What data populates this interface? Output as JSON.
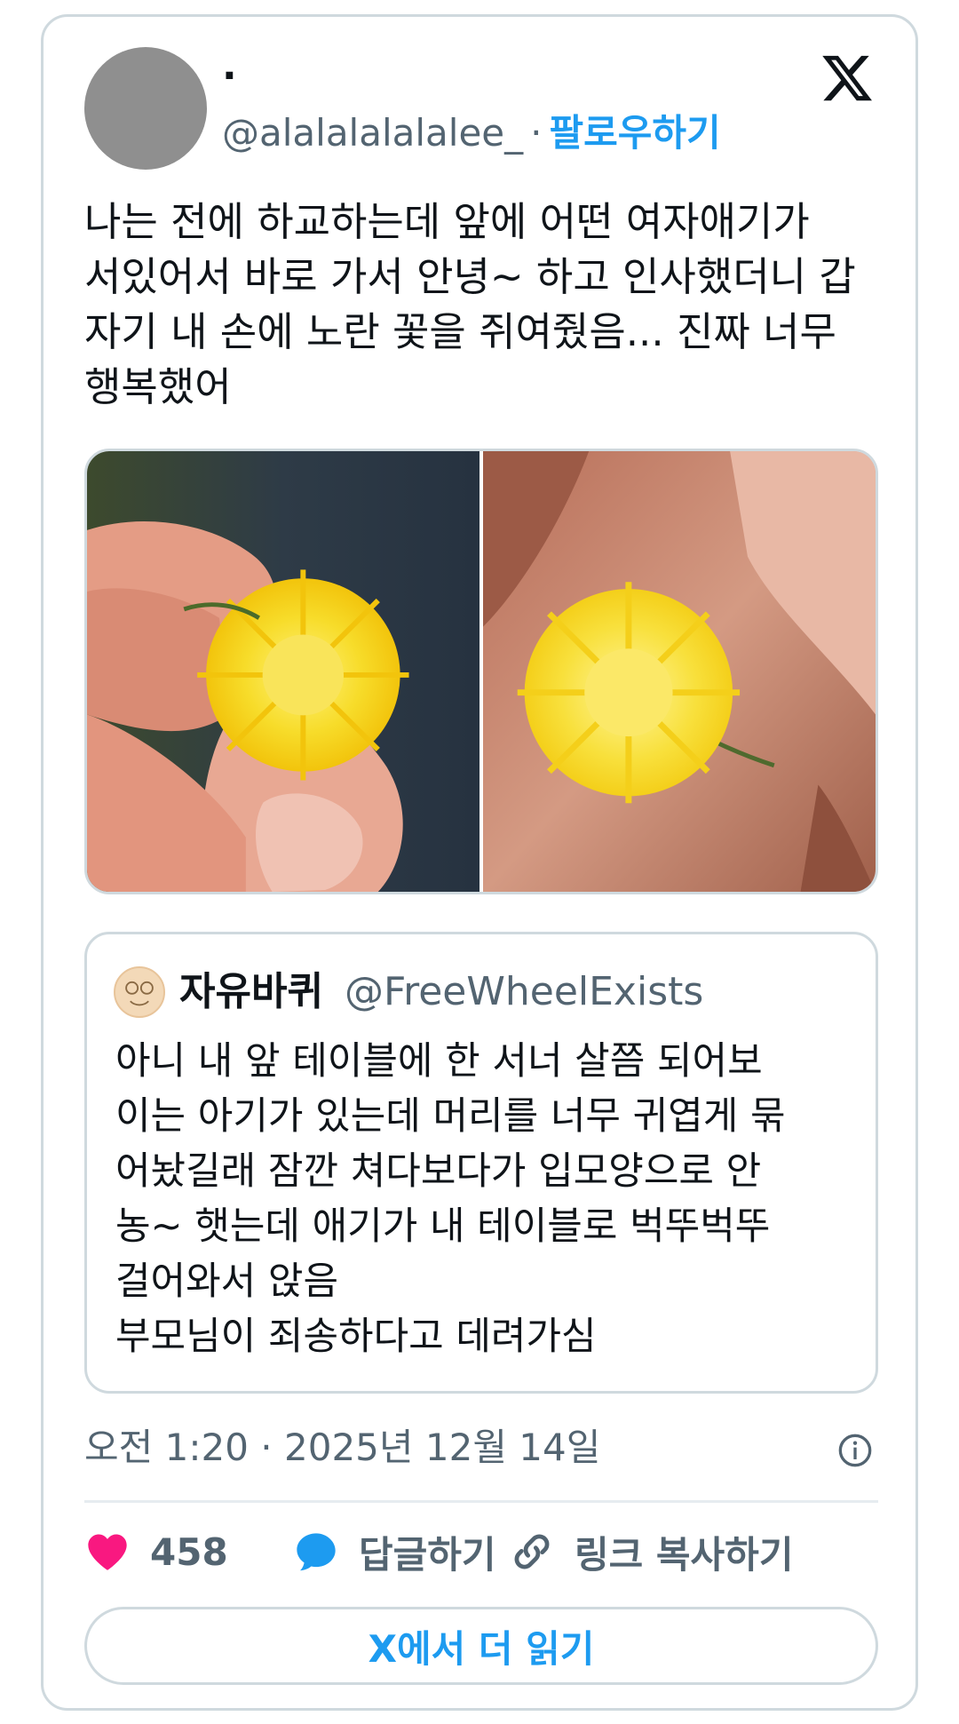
{
  "author": {
    "display_name": "·",
    "handle": "@alalalalalalee_",
    "separator": "·",
    "follow_label": "팔로우하기"
  },
  "tweet": {
    "text": "나는 전에 하교하는데 앞에 어떤 여자애기가\n서있어서 바로 가서 안녕~ 하고 인사했더니 갑\n자기 내 손에 노란 꽃을 쥐여줬음... 진짜 너무\n행복했어"
  },
  "quoted_tweet": {
    "display_name": "자유바퀴",
    "handle": "@FreeWheelExists",
    "text": "아니 내 앞 테이블에 한 서너 살쯤 되어보\n이는 아기가 있는데 머리를 너무 귀엽게 묶\n어놨길래 잠깐 쳐다보다가 입모양으로 안\n농~ 햇는데 애기가 내 테이블로 벅뚜벅뚜\n걸어와서 앉음\n부모님이 죄송하다고 데려가심"
  },
  "timestamp": "오전 1:20 · 2025년 12월 14일",
  "actions": {
    "like_count": "458",
    "reply_label": "답글하기",
    "copy_link_label": "링크 복사하기"
  },
  "read_more_label": "X에서 더 읽기",
  "icons": [
    "x-logo-icon",
    "heart-icon",
    "reply-bubble-icon",
    "link-icon",
    "info-icon"
  ],
  "colors": {
    "accent": "#1d9bf0",
    "like": "#f91880",
    "muted_text": "#536471",
    "border": "#cfd9de",
    "flower_yellow": "#f7dc2a"
  }
}
